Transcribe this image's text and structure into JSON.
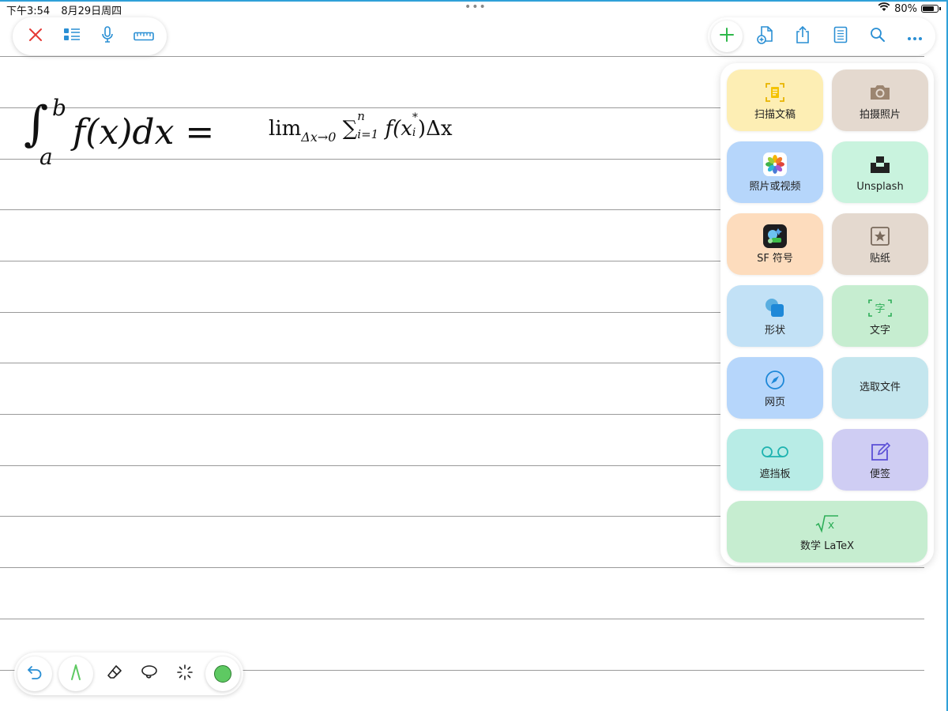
{
  "status_bar": {
    "time": "下午3:54",
    "date": "8月29日周四",
    "center_dots": "•••",
    "battery_percent": "80%",
    "battery_level": 0.8
  },
  "toolbar_left": {
    "icons": [
      "close-icon",
      "outline-list-icon",
      "microphone-icon",
      "ruler-icon"
    ]
  },
  "toolbar_right": {
    "icons": [
      "plus-icon",
      "add-page-icon",
      "share-icon",
      "page-layout-icon",
      "search-icon",
      "more-icon"
    ]
  },
  "formula": {
    "integral": "∫",
    "upper": "b",
    "lower": "a",
    "body": "f(x)dx =",
    "rhs_lim": "lim",
    "rhs_lim_sub": "Δx→0",
    "rhs_sum": "∑",
    "rhs_sum_sup": "n",
    "rhs_sum_sub": "i=1",
    "rhs_f": "f(x",
    "rhs_star": "*",
    "rhs_i": "i",
    "rhs_tail": ")Δx"
  },
  "insert_panel": {
    "items": [
      {
        "label": "扫描文稿",
        "icon": "scan-document-icon",
        "color": "#fdeeb4"
      },
      {
        "label": "拍摄照片",
        "icon": "camera-icon",
        "color": "#e4d9cf"
      },
      {
        "label": "照片或视频",
        "icon": "photos-icon",
        "color": "#b6d6fb"
      },
      {
        "label": "Unsplash",
        "icon": "unsplash-icon",
        "color": "#c9f3de"
      },
      {
        "label": "SF 符号",
        "icon": "sf-symbols-icon",
        "color": "#fddcbd"
      },
      {
        "label": "贴纸",
        "icon": "sticker-icon",
        "color": "#e4d9cf"
      },
      {
        "label": "形状",
        "icon": "shapes-icon",
        "color": "#c2e1f6"
      },
      {
        "label": "文字",
        "icon": "text-icon",
        "color": "#c6edd0"
      },
      {
        "label": "网页",
        "icon": "safari-compass-icon",
        "color": "#b6d6fb"
      },
      {
        "label": "选取文件",
        "icon": "",
        "color": "#c4e6ee"
      },
      {
        "label": "遮挡板",
        "icon": "mask-icon",
        "color": "#b8ece6"
      },
      {
        "label": "便签",
        "icon": "sticky-note-icon",
        "color": "#cfcdf3"
      },
      {
        "label": "数学 LaTeX",
        "icon": "math-sqrt-icon",
        "color": "#c6edd0"
      }
    ]
  },
  "toolbar_bottom": {
    "icons": [
      "undo-icon",
      "pen-icon",
      "eraser-icon",
      "lasso-icon",
      "magic-wand-icon",
      "color-swatch-icon"
    ],
    "current_color": "#5ec962"
  }
}
